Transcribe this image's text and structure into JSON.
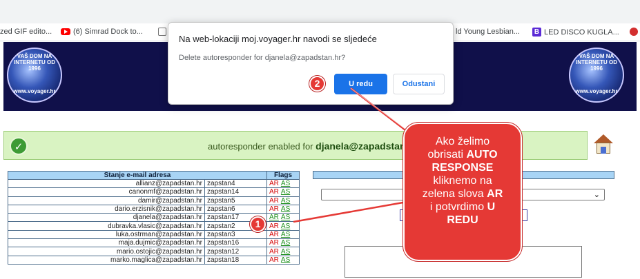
{
  "bookmarks": [
    {
      "label": "zed GIF edito...",
      "icon": "generic-icon"
    },
    {
      "label": "(6) Simrad Dock to...",
      "icon": "youtube-icon"
    },
    {
      "label": "ld Young Lesbian...",
      "icon": ""
    },
    {
      "label": "LED DISCO KUGLA...",
      "icon": "b-icon"
    }
  ],
  "header": {
    "globe_text_top": "VAŠ DOM NA INTERNETU OD 1996",
    "globe_text_bottom": "www.voyager.hr"
  },
  "dialog": {
    "title": "Na web-lokaciji moj.voyager.hr navodi se sljedeće",
    "message": "Delete autoresponder for djanela@zapadstan.hr?",
    "ok_label": "U redu",
    "cancel_label": "Odustani"
  },
  "status": {
    "text": "autoresponder enabled for",
    "email": "djanela@zapadstan."
  },
  "table": {
    "headers": {
      "email": "Stanje e-mail adresa",
      "flags": "Flags"
    },
    "flag_ar": "AR",
    "flag_as": "AS",
    "rows": [
      {
        "email": "allianz@zapadstan.hr",
        "user": "zapstan4",
        "ar_on": false
      },
      {
        "email": "canonmf@zapadstan.hr",
        "user": "zapstan14",
        "ar_on": false
      },
      {
        "email": "damir@zapadstan.hr",
        "user": "zapstan5",
        "ar_on": false
      },
      {
        "email": "dario.erzisnik@zapadstan.hr",
        "user": "zapstan6",
        "ar_on": false
      },
      {
        "email": "djanela@zapadstan.hr",
        "user": "zapstan17",
        "ar_on": true
      },
      {
        "email": "dubravka.vlasic@zapadstan.hr",
        "user": "zapstan2",
        "ar_on": false
      },
      {
        "email": "luka.ostrman@zapadstan.hr",
        "user": "zapstan3",
        "ar_on": false
      },
      {
        "email": "maja.dujmic@zapadstan.hr",
        "user": "zapstan16",
        "ar_on": false
      },
      {
        "email": "mario.ostojic@zapadstan.hr",
        "user": "zapstan12",
        "ar_on": false
      },
      {
        "email": "marko.maglica@zapadstan.hr",
        "user": "zapstan18",
        "ar_on": false
      }
    ]
  },
  "annotations": {
    "badge_1": "1",
    "badge_2": "2",
    "callout": {
      "l1": "Ako želimo",
      "l2": "obrisati",
      "l2b": "AUTO",
      "l3": "RESPONSE",
      "l4": "kliknemo na",
      "l5": "zelena slova",
      "l5b": "AR",
      "l6": "i potvrdimo",
      "l6b": "U",
      "l7": "REDU"
    }
  },
  "colors": {
    "accent": "#1a73e8",
    "annotation": "#e53935",
    "success": "#d9f3c2"
  }
}
